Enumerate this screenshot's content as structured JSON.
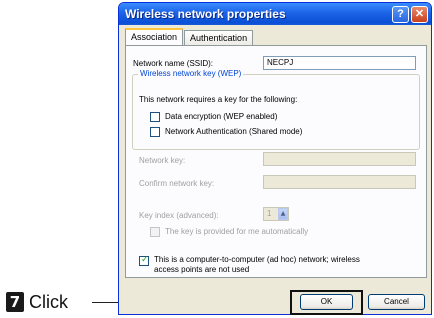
{
  "callout": {
    "step": "7",
    "action": "Click"
  },
  "window": {
    "title": "Wireless network properties",
    "help_glyph": "?",
    "close_glyph": "✕"
  },
  "tabs": [
    {
      "label": "Association",
      "active": true
    },
    {
      "label": "Authentication",
      "active": false
    }
  ],
  "association": {
    "ssid_label": "Network name (SSID):",
    "ssid_value": "NECPJ",
    "wep_group_title": "Wireless network key (WEP)",
    "wep_intro": "This network requires a key for the following:",
    "data_encryption_label": "Data encryption (WEP enabled)",
    "data_encryption_checked": false,
    "shared_auth_label": "Network Authentication (Shared mode)",
    "shared_auth_checked": false,
    "network_key_label": "Network key:",
    "network_key_value": "",
    "confirm_key_label": "Confirm network key:",
    "confirm_key_value": "",
    "key_index_label": "Key index (advanced):",
    "key_index_value": "1",
    "key_auto_label": "The key is provided for me automatically",
    "key_auto_checked": false,
    "adhoc_label_line1": "This is a computer-to-computer (ad hoc) network; wireless",
    "adhoc_label_line2": "access points are not used",
    "adhoc_checked": true
  },
  "buttons": {
    "ok": "OK",
    "cancel": "Cancel"
  },
  "colors": {
    "titlebar": "#0a4fd6",
    "dialog_bg": "#ece9d8",
    "group_title": "#0046d5",
    "check": "#21a121"
  }
}
